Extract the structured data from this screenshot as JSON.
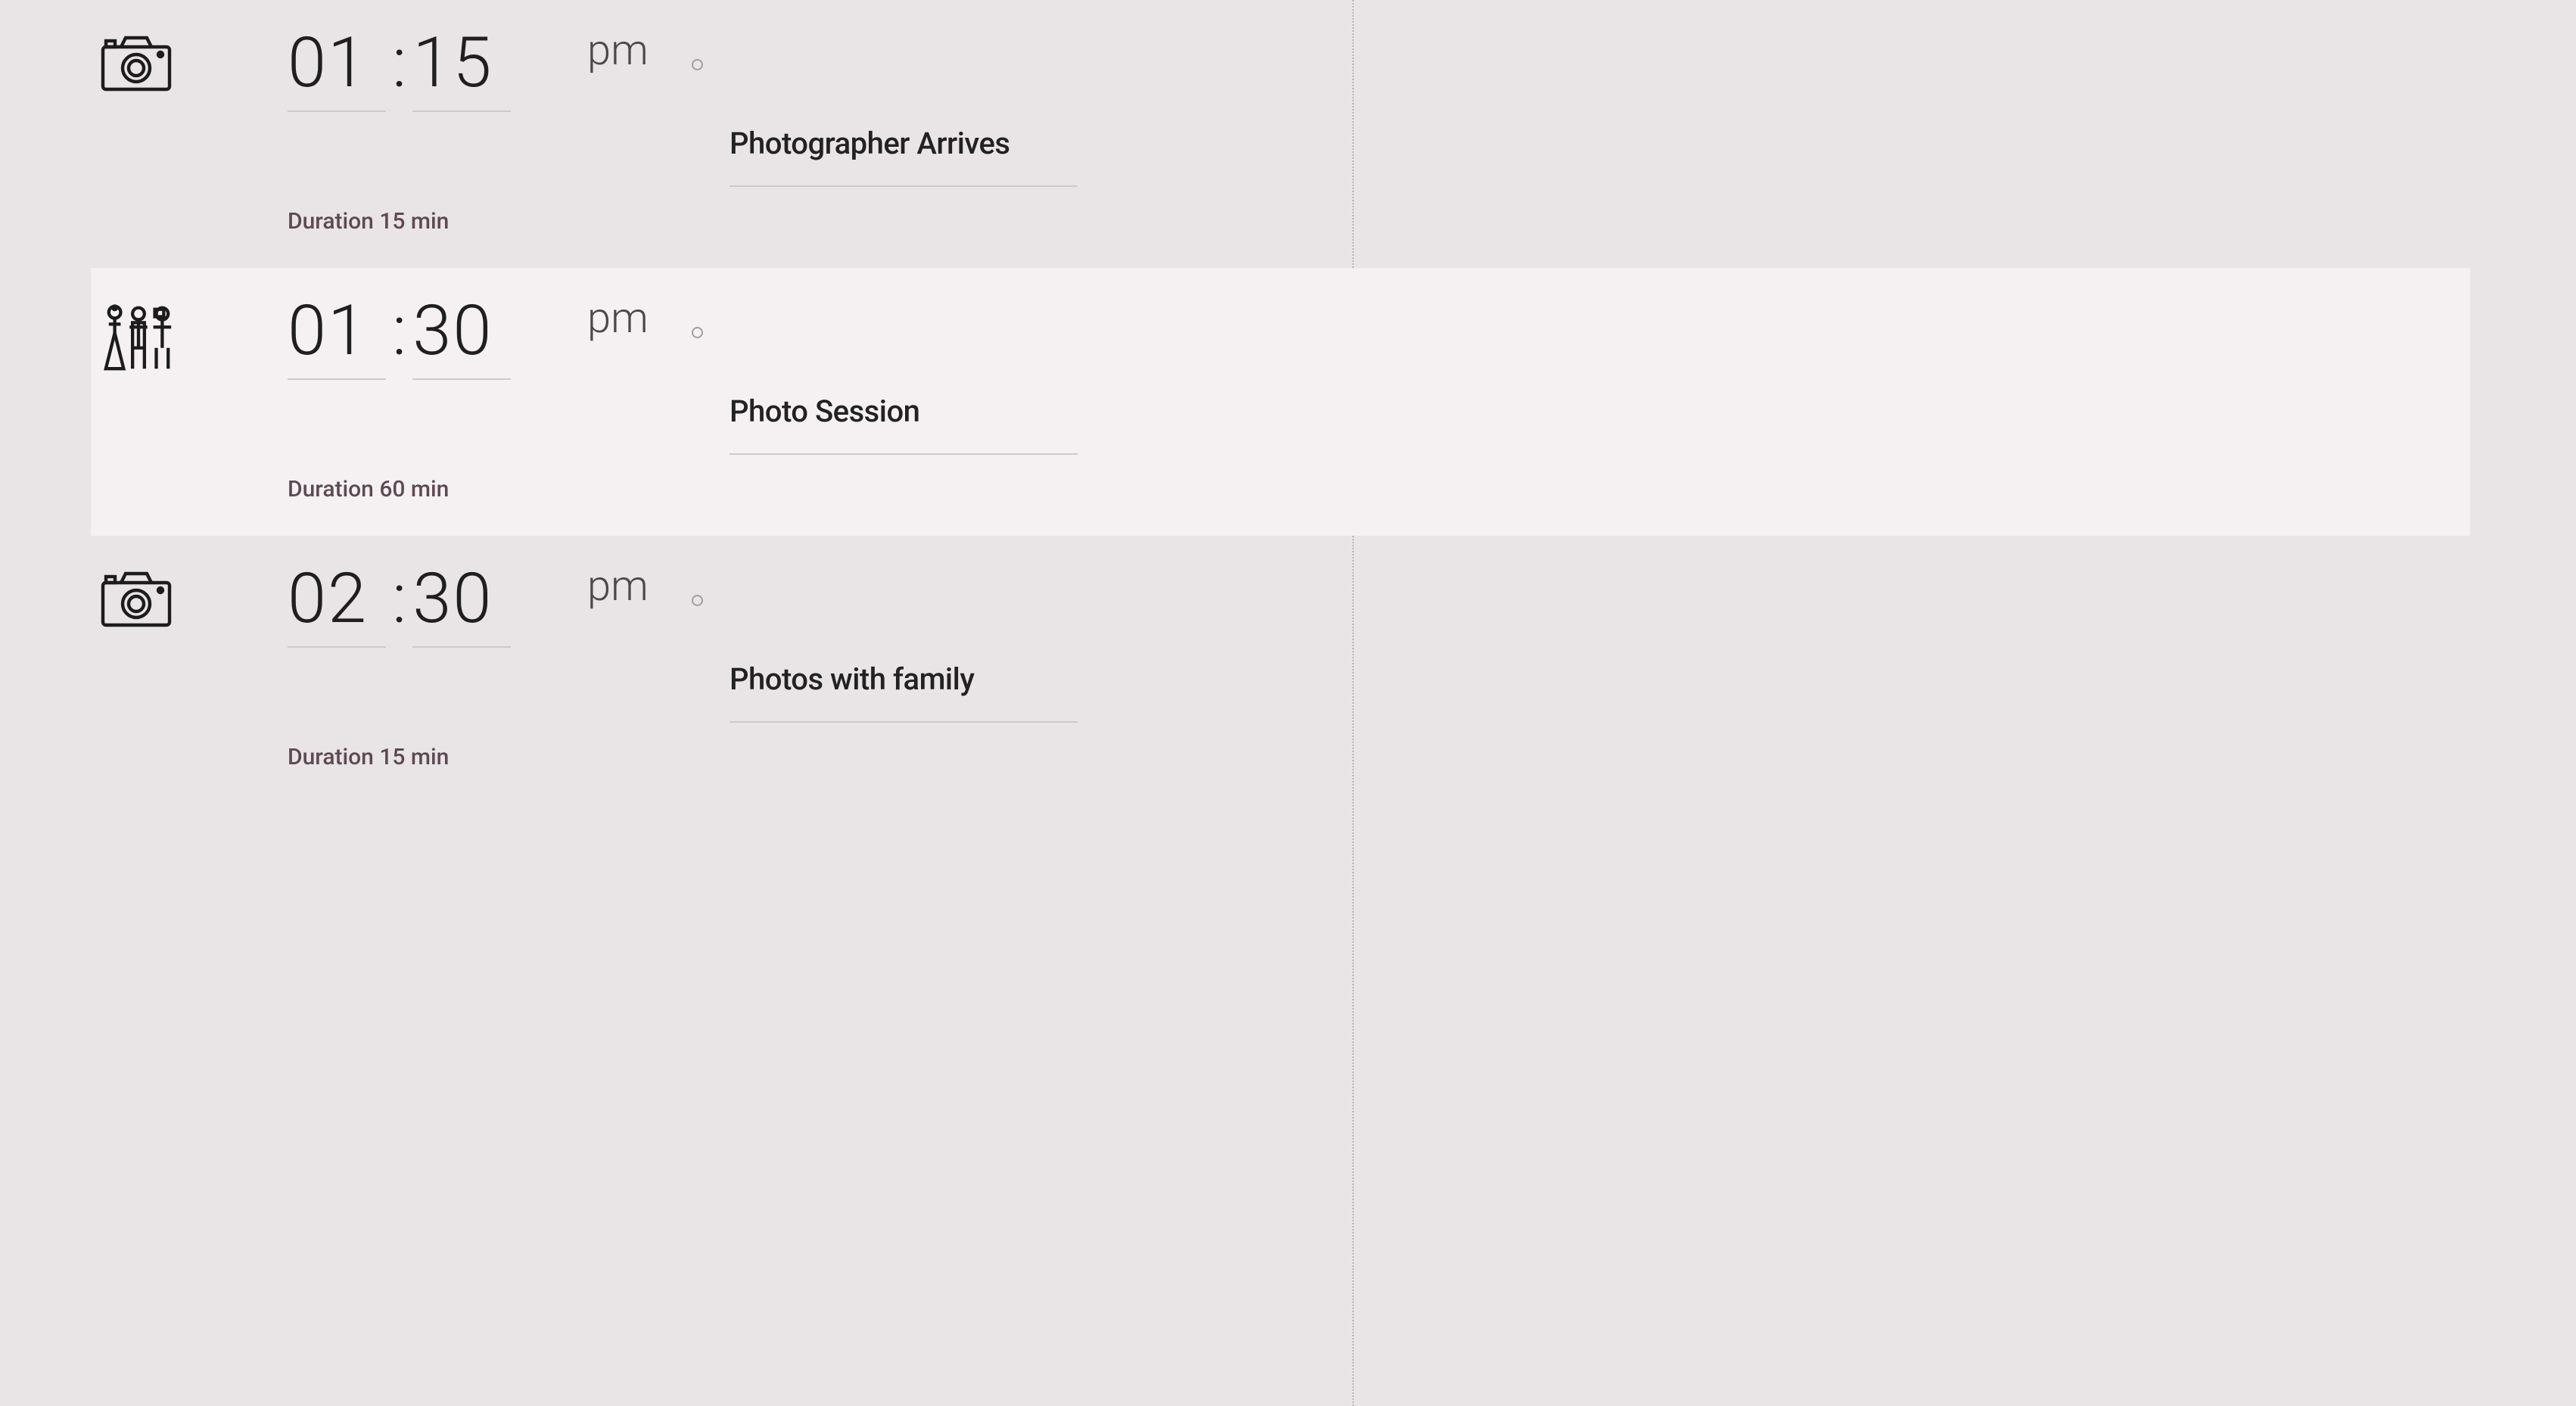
{
  "timeline": {
    "events": [
      {
        "icon": "camera",
        "hour": "01",
        "minute": "15",
        "ampm": "pm",
        "duration": "Duration 15 min",
        "title": "Photographer Arrives",
        "highlight": false
      },
      {
        "icon": "people",
        "hour": "01",
        "minute": "30",
        "ampm": "pm",
        "duration": "Duration 60 min",
        "title": "Photo Session",
        "highlight": true
      },
      {
        "icon": "camera",
        "hour": "02",
        "minute": "30",
        "ampm": "pm",
        "duration": "Duration 15 min",
        "title": "Photos with family",
        "highlight": false
      }
    ]
  }
}
